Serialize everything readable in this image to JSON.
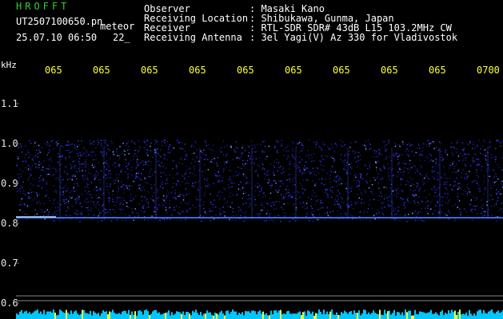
{
  "header": {
    "app_title": "HROFFT",
    "file_name": "UT2507100650.pn",
    "mode": "meteor",
    "datetime": "25.07.10 06:50",
    "value_22": "22_"
  },
  "info": [
    {
      "label": "Observer",
      "value": ": Masaki Kano"
    },
    {
      "label": "Receiving Location",
      "value": ": Shibukawa, Gunma, Japan"
    },
    {
      "label": "Receiver",
      "value": ": RTL-SDR SDR# 43dB L15 103.2MHz CW"
    },
    {
      "label": "Receiving Antenna",
      "value": ": 3el Yagi(V) Az 330 for Vladivostok"
    }
  ],
  "axis": {
    "unit": "kHz",
    "x_ticks": [
      "065",
      "065",
      "065",
      "065",
      "065",
      "065",
      "065",
      "065",
      "065",
      "0700"
    ],
    "y_ticks": [
      "1.1",
      "1.0",
      "0.9",
      "0.8",
      "0.7",
      "0.6"
    ]
  },
  "colors": {
    "background": "#000000",
    "title": "#2fd02f",
    "tick_x": "#ffff3c",
    "signal": "#2c3cff",
    "bottom_bar": "#00c8ff"
  }
}
